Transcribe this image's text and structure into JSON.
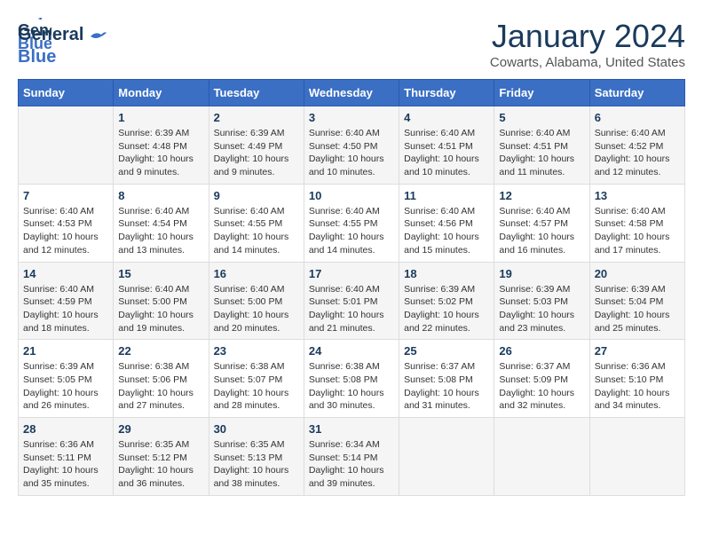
{
  "app": {
    "logo_general": "General",
    "logo_blue": "Blue",
    "month": "January 2024",
    "location": "Cowarts, Alabama, United States"
  },
  "calendar": {
    "headers": [
      "Sunday",
      "Monday",
      "Tuesday",
      "Wednesday",
      "Thursday",
      "Friday",
      "Saturday"
    ],
    "rows": [
      [
        {
          "num": "",
          "info": ""
        },
        {
          "num": "1",
          "info": "Sunrise: 6:39 AM\nSunset: 4:48 PM\nDaylight: 10 hours\nand 9 minutes."
        },
        {
          "num": "2",
          "info": "Sunrise: 6:39 AM\nSunset: 4:49 PM\nDaylight: 10 hours\nand 9 minutes."
        },
        {
          "num": "3",
          "info": "Sunrise: 6:40 AM\nSunset: 4:50 PM\nDaylight: 10 hours\nand 10 minutes."
        },
        {
          "num": "4",
          "info": "Sunrise: 6:40 AM\nSunset: 4:51 PM\nDaylight: 10 hours\nand 10 minutes."
        },
        {
          "num": "5",
          "info": "Sunrise: 6:40 AM\nSunset: 4:51 PM\nDaylight: 10 hours\nand 11 minutes."
        },
        {
          "num": "6",
          "info": "Sunrise: 6:40 AM\nSunset: 4:52 PM\nDaylight: 10 hours\nand 12 minutes."
        }
      ],
      [
        {
          "num": "7",
          "info": "Sunrise: 6:40 AM\nSunset: 4:53 PM\nDaylight: 10 hours\nand 12 minutes."
        },
        {
          "num": "8",
          "info": "Sunrise: 6:40 AM\nSunset: 4:54 PM\nDaylight: 10 hours\nand 13 minutes."
        },
        {
          "num": "9",
          "info": "Sunrise: 6:40 AM\nSunset: 4:55 PM\nDaylight: 10 hours\nand 14 minutes."
        },
        {
          "num": "10",
          "info": "Sunrise: 6:40 AM\nSunset: 4:55 PM\nDaylight: 10 hours\nand 14 minutes."
        },
        {
          "num": "11",
          "info": "Sunrise: 6:40 AM\nSunset: 4:56 PM\nDaylight: 10 hours\nand 15 minutes."
        },
        {
          "num": "12",
          "info": "Sunrise: 6:40 AM\nSunset: 4:57 PM\nDaylight: 10 hours\nand 16 minutes."
        },
        {
          "num": "13",
          "info": "Sunrise: 6:40 AM\nSunset: 4:58 PM\nDaylight: 10 hours\nand 17 minutes."
        }
      ],
      [
        {
          "num": "14",
          "info": "Sunrise: 6:40 AM\nSunset: 4:59 PM\nDaylight: 10 hours\nand 18 minutes."
        },
        {
          "num": "15",
          "info": "Sunrise: 6:40 AM\nSunset: 5:00 PM\nDaylight: 10 hours\nand 19 minutes."
        },
        {
          "num": "16",
          "info": "Sunrise: 6:40 AM\nSunset: 5:00 PM\nDaylight: 10 hours\nand 20 minutes."
        },
        {
          "num": "17",
          "info": "Sunrise: 6:40 AM\nSunset: 5:01 PM\nDaylight: 10 hours\nand 21 minutes."
        },
        {
          "num": "18",
          "info": "Sunrise: 6:39 AM\nSunset: 5:02 PM\nDaylight: 10 hours\nand 22 minutes."
        },
        {
          "num": "19",
          "info": "Sunrise: 6:39 AM\nSunset: 5:03 PM\nDaylight: 10 hours\nand 23 minutes."
        },
        {
          "num": "20",
          "info": "Sunrise: 6:39 AM\nSunset: 5:04 PM\nDaylight: 10 hours\nand 25 minutes."
        }
      ],
      [
        {
          "num": "21",
          "info": "Sunrise: 6:39 AM\nSunset: 5:05 PM\nDaylight: 10 hours\nand 26 minutes."
        },
        {
          "num": "22",
          "info": "Sunrise: 6:38 AM\nSunset: 5:06 PM\nDaylight: 10 hours\nand 27 minutes."
        },
        {
          "num": "23",
          "info": "Sunrise: 6:38 AM\nSunset: 5:07 PM\nDaylight: 10 hours\nand 28 minutes."
        },
        {
          "num": "24",
          "info": "Sunrise: 6:38 AM\nSunset: 5:08 PM\nDaylight: 10 hours\nand 30 minutes."
        },
        {
          "num": "25",
          "info": "Sunrise: 6:37 AM\nSunset: 5:08 PM\nDaylight: 10 hours\nand 31 minutes."
        },
        {
          "num": "26",
          "info": "Sunrise: 6:37 AM\nSunset: 5:09 PM\nDaylight: 10 hours\nand 32 minutes."
        },
        {
          "num": "27",
          "info": "Sunrise: 6:36 AM\nSunset: 5:10 PM\nDaylight: 10 hours\nand 34 minutes."
        }
      ],
      [
        {
          "num": "28",
          "info": "Sunrise: 6:36 AM\nSunset: 5:11 PM\nDaylight: 10 hours\nand 35 minutes."
        },
        {
          "num": "29",
          "info": "Sunrise: 6:35 AM\nSunset: 5:12 PM\nDaylight: 10 hours\nand 36 minutes."
        },
        {
          "num": "30",
          "info": "Sunrise: 6:35 AM\nSunset: 5:13 PM\nDaylight: 10 hours\nand 38 minutes."
        },
        {
          "num": "31",
          "info": "Sunrise: 6:34 AM\nSunset: 5:14 PM\nDaylight: 10 hours\nand 39 minutes."
        },
        {
          "num": "",
          "info": ""
        },
        {
          "num": "",
          "info": ""
        },
        {
          "num": "",
          "info": ""
        }
      ]
    ]
  }
}
